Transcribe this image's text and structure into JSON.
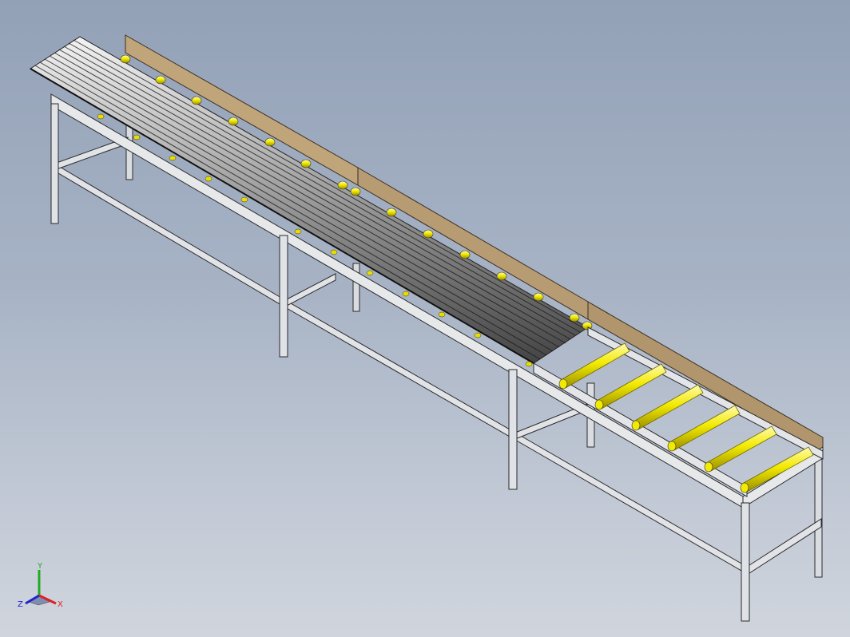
{
  "viewport": {
    "background_top": "#93a1b7",
    "background_bottom": "#d0d5dd"
  },
  "model": {
    "frame_color": "#d9dce0",
    "frame_edge": "#2a2a2a",
    "roller_highlight_color": "#f2ea00",
    "guide_rail_color": "#b69b73"
  },
  "triad": {
    "x_label": "X",
    "y_label": "Y",
    "z_label": "Z",
    "x_color": "#d22",
    "y_color": "#2a2",
    "z_color": "#22c"
  }
}
